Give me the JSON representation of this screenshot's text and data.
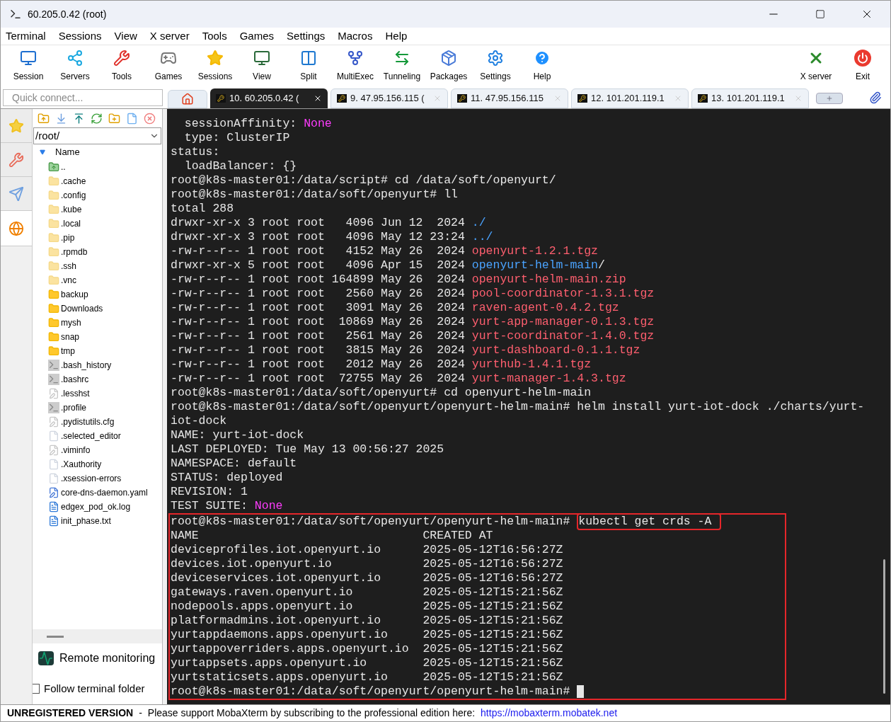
{
  "window": {
    "title": "60.205.0.42 (root)"
  },
  "menu": [
    "Terminal",
    "Sessions",
    "View",
    "X server",
    "Tools",
    "Games",
    "Settings",
    "Macros",
    "Help"
  ],
  "toolbar": [
    {
      "label": "Session",
      "kind": "session"
    },
    {
      "label": "Servers",
      "kind": "servers"
    },
    {
      "label": "Tools",
      "kind": "tools"
    },
    {
      "label": "Games",
      "kind": "games"
    },
    {
      "label": "Sessions",
      "kind": "star"
    },
    {
      "label": "View",
      "kind": "view"
    },
    {
      "label": "Split",
      "kind": "split"
    },
    {
      "label": "MultiExec",
      "kind": "fork"
    },
    {
      "label": "Tunneling",
      "kind": "tunnel"
    },
    {
      "label": "Packages",
      "kind": "package"
    },
    {
      "label": "Settings",
      "kind": "gears"
    },
    {
      "label": "Help",
      "kind": "help"
    }
  ],
  "toolbar_right": [
    {
      "label": "X server",
      "kind": "x"
    },
    {
      "label": "Exit",
      "kind": "power"
    }
  ],
  "quick_connect": {
    "placeholder": "Quick connect..."
  },
  "tabs": [
    {
      "label": "10. 60.205.0.42 (",
      "selected": true
    },
    {
      "label": "9. 47.95.156.115 (",
      "selected": false
    },
    {
      "label": "11. 47.95.156.115",
      "selected": false
    },
    {
      "label": "12. 101.201.119.1",
      "selected": false
    },
    {
      "label": "13. 101.201.119.1",
      "selected": false
    }
  ],
  "side_tabs": [
    {
      "kind": "star",
      "selected": false
    },
    {
      "kind": "tools",
      "selected": false
    },
    {
      "kind": "plane",
      "selected": false
    },
    {
      "kind": "globe",
      "selected": true
    }
  ],
  "file_panel": {
    "path": "/root/",
    "column": "Name",
    "files": [
      {
        "name": "..",
        "kind": "up"
      },
      {
        "name": ".cache",
        "kind": "hidden_folder"
      },
      {
        "name": ".config",
        "kind": "hidden_folder"
      },
      {
        "name": ".kube",
        "kind": "hidden_folder"
      },
      {
        "name": ".local",
        "kind": "hidden_folder"
      },
      {
        "name": ".pip",
        "kind": "hidden_folder"
      },
      {
        "name": ".rpmdb",
        "kind": "hidden_folder"
      },
      {
        "name": ".ssh",
        "kind": "hidden_folder"
      },
      {
        "name": ".vnc",
        "kind": "hidden_folder"
      },
      {
        "name": "backup",
        "kind": "folder"
      },
      {
        "name": "Downloads",
        "kind": "folder"
      },
      {
        "name": "mysh",
        "kind": "folder"
      },
      {
        "name": "snap",
        "kind": "folder"
      },
      {
        "name": "tmp",
        "kind": "folder"
      },
      {
        "name": ".bash_history",
        "kind": "script"
      },
      {
        "name": ".bashrc",
        "kind": "script"
      },
      {
        "name": ".lesshst",
        "kind": "edited"
      },
      {
        "name": ".profile",
        "kind": "script"
      },
      {
        "name": ".pydistutils.cfg",
        "kind": "edited"
      },
      {
        "name": ".selected_editor",
        "kind": "plain"
      },
      {
        "name": ".viminfo",
        "kind": "edited"
      },
      {
        "name": ".Xauthority",
        "kind": "plain"
      },
      {
        "name": ".xsession-errors",
        "kind": "plain"
      },
      {
        "name": "core-dns-daemon.yaml",
        "kind": "yaml"
      },
      {
        "name": "edgex_pod_ok.log",
        "kind": "doc"
      },
      {
        "name": "init_phase.txt",
        "kind": "doc"
      }
    ],
    "remote_monitoring": "Remote monitoring",
    "follow_folder": {
      "label": "Follow terminal folder",
      "checked": false
    }
  },
  "terminal": {
    "lines": [
      [
        {
          "t": "  sessionAffinity: ",
          "kind": "plain"
        },
        {
          "t": "None",
          "kind": "magenta"
        }
      ],
      [
        {
          "t": "  type: ClusterIP",
          "kind": "plain"
        }
      ],
      [
        {
          "t": "status:",
          "kind": "plain"
        }
      ],
      [
        {
          "t": "  loadBalancer: {}",
          "kind": "plain"
        }
      ],
      [
        {
          "t": "root@k8s-master01:/data/script# cd /data/soft/openyurt/",
          "kind": "plain"
        }
      ],
      [
        {
          "t": "root@k8s-master01:/data/soft/openyurt# ll",
          "kind": "plain"
        }
      ],
      [
        {
          "t": "total 288",
          "kind": "plain"
        }
      ],
      [
        {
          "t": "drwxr-xr-x 3 root root   4096 Jun 12  2024 ",
          "kind": "plain"
        },
        {
          "t": "./",
          "kind": "dir"
        }
      ],
      [
        {
          "t": "drwxr-xr-x 3 root root   4096 May 12 23:24 ",
          "kind": "plain"
        },
        {
          "t": "../",
          "kind": "dir"
        }
      ],
      [
        {
          "t": "-rw-r--r-- 1 root root   4152 May 26  2024 ",
          "kind": "plain"
        },
        {
          "t": "openyurt-1.2.1.tgz",
          "kind": "archive"
        }
      ],
      [
        {
          "t": "drwxr-xr-x 5 root root   4096 Apr 15  2024 ",
          "kind": "plain"
        },
        {
          "t": "openyurt-helm-main",
          "kind": "dir"
        },
        {
          "t": "/",
          "kind": "plain"
        }
      ],
      [
        {
          "t": "-rw-r--r-- 1 root root 164899 May 26  2024 ",
          "kind": "plain"
        },
        {
          "t": "openyurt-helm-main.zip",
          "kind": "archive"
        }
      ],
      [
        {
          "t": "-rw-r--r-- 1 root root   2560 May 26  2024 ",
          "kind": "plain"
        },
        {
          "t": "pool-coordinator-1.3.1.tgz",
          "kind": "archive"
        }
      ],
      [
        {
          "t": "-rw-r--r-- 1 root root   3091 May 26  2024 ",
          "kind": "plain"
        },
        {
          "t": "raven-agent-0.4.2.tgz",
          "kind": "archive"
        }
      ],
      [
        {
          "t": "-rw-r--r-- 1 root root  10869 May 26  2024 ",
          "kind": "plain"
        },
        {
          "t": "yurt-app-manager-0.1.3.tgz",
          "kind": "archive"
        }
      ],
      [
        {
          "t": "-rw-r--r-- 1 root root   2561 May 26  2024 ",
          "kind": "plain"
        },
        {
          "t": "yurt-coordinator-1.4.0.tgz",
          "kind": "archive"
        }
      ],
      [
        {
          "t": "-rw-r--r-- 1 root root   3815 May 26  2024 ",
          "kind": "plain"
        },
        {
          "t": "yurt-dashboard-0.1.1.tgz",
          "kind": "archive"
        }
      ],
      [
        {
          "t": "-rw-r--r-- 1 root root   2012 May 26  2024 ",
          "kind": "plain"
        },
        {
          "t": "yurthub-1.4.1.tgz",
          "kind": "archive"
        }
      ],
      [
        {
          "t": "-rw-r--r-- 1 root root  72755 May 26  2024 ",
          "kind": "plain"
        },
        {
          "t": "yurt-manager-1.4.3.tgz",
          "kind": "archive"
        }
      ],
      [
        {
          "t": "root@k8s-master01:/data/soft/openyurt# cd openyurt-helm-main",
          "kind": "plain"
        }
      ],
      [
        {
          "t": "root@k8s-master01:/data/soft/openyurt/openyurt-helm-main# helm install yurt-iot-dock ./charts/yurt-",
          "kind": "plain"
        }
      ],
      [
        {
          "t": "iot-dock",
          "kind": "plain"
        }
      ],
      [
        {
          "t": "NAME: yurt-iot-dock",
          "kind": "plain"
        }
      ],
      [
        {
          "t": "LAST DEPLOYED: Tue May 13 00:56:27 2025",
          "kind": "plain"
        }
      ],
      [
        {
          "t": "NAMESPACE: default",
          "kind": "plain"
        }
      ],
      [
        {
          "t": "STATUS: deployed",
          "kind": "plain"
        }
      ],
      [
        {
          "t": "REVISION: 1",
          "kind": "plain"
        }
      ],
      [
        {
          "t": "TEST SUITE: ",
          "kind": "plain"
        },
        {
          "t": "None",
          "kind": "magenta"
        }
      ]
    ],
    "highlighted_lines": [
      [
        {
          "t": "root@k8s-master01:/data/soft/openyurt/openyurt-helm-main# ",
          "kind": "plain"
        },
        {
          "t": "kubectl get crds -A ",
          "kind": "boxed"
        }
      ],
      [
        {
          "t": "NAME                                CREATED AT",
          "kind": "plain"
        }
      ],
      [
        {
          "t": "deviceprofiles.iot.openyurt.io      2025-05-12T16:56:27Z",
          "kind": "plain"
        }
      ],
      [
        {
          "t": "devices.iot.openyurt.io             2025-05-12T16:56:27Z",
          "kind": "plain"
        }
      ],
      [
        {
          "t": "deviceservices.iot.openyurt.io      2025-05-12T16:56:27Z",
          "kind": "plain"
        }
      ],
      [
        {
          "t": "gateways.raven.openyurt.io          2025-05-12T15:21:56Z",
          "kind": "plain"
        }
      ],
      [
        {
          "t": "nodepools.apps.openyurt.io          2025-05-12T15:21:56Z",
          "kind": "plain"
        }
      ],
      [
        {
          "t": "platformadmins.iot.openyurt.io      2025-05-12T15:21:56Z",
          "kind": "plain"
        }
      ],
      [
        {
          "t": "yurtappdaemons.apps.openyurt.io     2025-05-12T15:21:56Z",
          "kind": "plain"
        }
      ],
      [
        {
          "t": "yurtappoverriders.apps.openyurt.io  2025-05-12T15:21:56Z",
          "kind": "plain"
        }
      ],
      [
        {
          "t": "yurtappsets.apps.openyurt.io        2025-05-12T15:21:56Z",
          "kind": "plain"
        }
      ],
      [
        {
          "t": "yurtstaticsets.apps.openyurt.io     2025-05-12T15:21:56Z",
          "kind": "plain"
        }
      ],
      [
        {
          "t": "root@k8s-master01:/data/soft/openyurt/openyurt-helm-main# ",
          "kind": "plain"
        },
        {
          "kind": "cursor"
        }
      ]
    ]
  },
  "status_bar": {
    "label": "UNREGISTERED VERSION",
    "separator": "-",
    "message": "Please support MobaXterm by subscribing to the professional edition here:",
    "link": "https://mobaxterm.mobatek.net"
  }
}
